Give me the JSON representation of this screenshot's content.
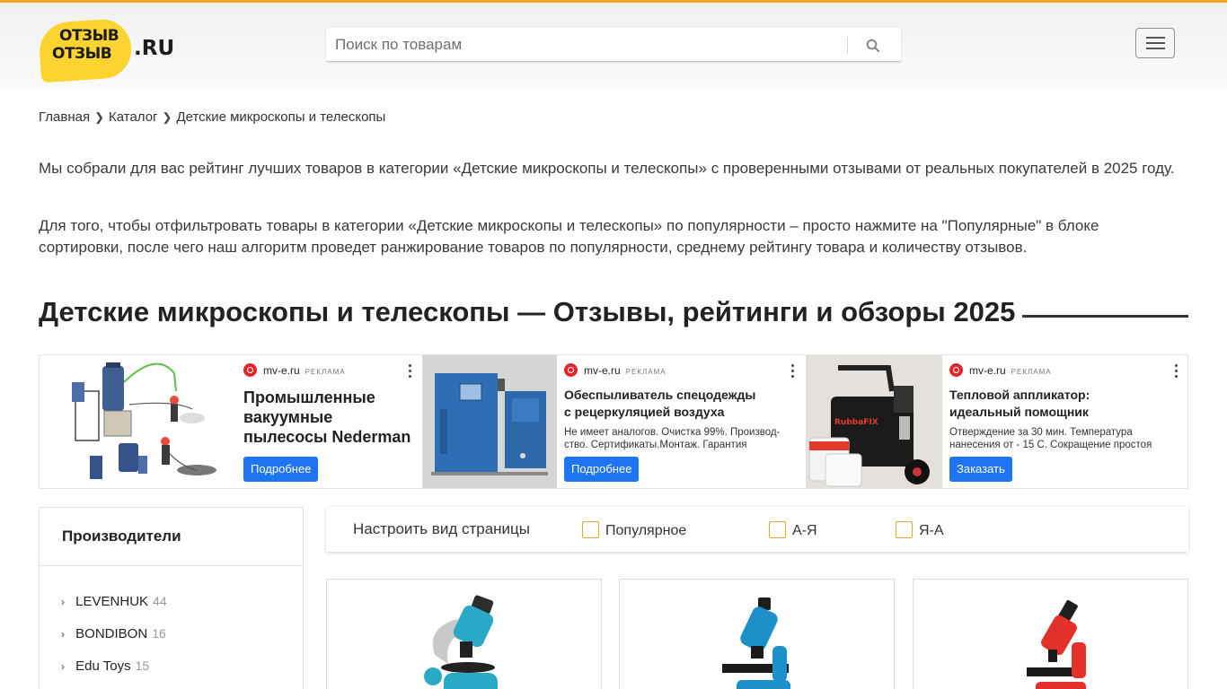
{
  "header": {
    "logo_line1": "ОТЗЫВ",
    "logo_line2": "ОТЗЫВ",
    "logo_domain": ".RU",
    "search_placeholder": "Поиск по товарам",
    "accent_color": "#f4a62a",
    "logo_color": "#fcd431"
  },
  "breadcrumb": [
    "Главная",
    "Каталог",
    "Детские микроскопы и телескопы"
  ],
  "intro": {
    "p1": "Мы собрали для вас рейтинг лучших товаров в категории «Детские микроскопы и телескопы» с проверенными отзывами от реальных покупателей в 2025 году.",
    "p2": "Для того, чтобы отфильтровать товары в категории «Детские микроскопы и телескопы» по популярности – просто нажмите на \"Популярные\" в блоке сортировки, после чего наш алгоритм проведет ранжирование товаров по популярности, среднему рейтингу товара и количеству отзывов."
  },
  "page_title": "Детские микроскопы и телескопы — Отзывы, рейтинги и обзоры 2025",
  "ads": [
    {
      "domain": "mv-e.ru",
      "mark": "РЕКЛАМА",
      "title": "Промышленные вакуумные пылесосы Nederman",
      "text": "",
      "button": "Подробнее"
    },
    {
      "domain": "mv-e.ru",
      "mark": "РЕКЛАМА",
      "title": "Обеспыливатель спецодежды с рецеркуляцией воздуха",
      "text": "Не имеет аналогов. Очистка 99%. Производ-ство. Сертификаты.Монтаж. Гарантия",
      "button": "Подробнее"
    },
    {
      "domain": "mv-e.ru",
      "mark": "РЕКЛАМА",
      "title": "Тепловой аппликатор: идеальный помощник",
      "text": "Отверждение за 30 мин. Температура нанесения от - 15 С. Сокращение простоя",
      "button": "Заказать",
      "image_text": "RubbaFIX"
    }
  ],
  "sidebar": {
    "title": "Производители",
    "brands": [
      {
        "name": "LEVENHUK",
        "count": "44"
      },
      {
        "name": "BONDIBON",
        "count": "16"
      },
      {
        "name": "Edu Toys",
        "count": "15"
      }
    ]
  },
  "sort": {
    "label": "Настроить вид страницы",
    "options": [
      "Популярное",
      "А-Я",
      "Я-А"
    ]
  },
  "products": [
    {
      "image": "microscope-turquoise"
    },
    {
      "image": "microscope-blue"
    },
    {
      "image": "microscope-red"
    }
  ]
}
